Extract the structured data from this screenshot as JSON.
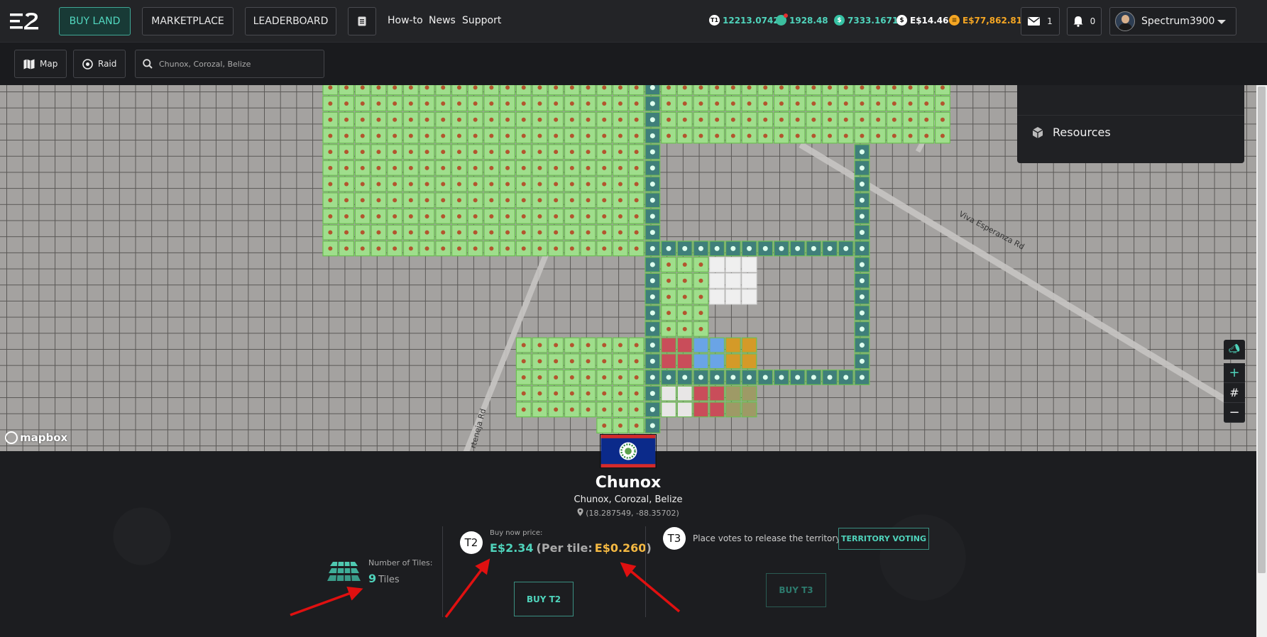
{
  "nav": {
    "buy_land": "BUY LAND",
    "marketplace": "MARKETPLACE",
    "leaderboard": "LEADERBOARD",
    "links": [
      "How-to",
      "News",
      "Support"
    ],
    "stats": [
      {
        "icon": "t1-token-icon",
        "value": "12213.0742",
        "color": "#4fd3bb"
      },
      {
        "icon": "essence-icon",
        "value": "1928.48",
        "color": "#4fd3bb"
      },
      {
        "icon": "coin-icon",
        "value": "7333.1671",
        "color": "#4fd3bb"
      },
      {
        "icon": "dollar-icon",
        "value": "E$14.46",
        "color": "#ffffff"
      },
      {
        "icon": "gold-coin-icon",
        "value": "E$77,862.81",
        "color": "#f5a623"
      }
    ],
    "mail_count": "1",
    "notification_count": "0",
    "username": "Spectrum3900"
  },
  "toolbar": {
    "map_label": "Map",
    "raid_label": "Raid",
    "search_placeholder": "Chunox, Corozal, Belize"
  },
  "map": {
    "road_label_1": "Viva Esperanza Rd",
    "road_label_2": "rteneja Rd",
    "attribution": "mapbox",
    "resources_label": "Resources"
  },
  "territory": {
    "name": "Chunox",
    "location": "Chunox, Corozal, Belize",
    "coordinates": "(18.287549, -88.35702)",
    "tiles_label": "Number of Tiles:",
    "tiles_count": "9",
    "tiles_unit": "Tiles",
    "t2_badge": "T2",
    "buy_now_label": "Buy now price:",
    "buy_now_price": "E$2.34",
    "per_tile_label": "(Per tile:",
    "per_tile_price": "E$0.260",
    "per_tile_close": ")",
    "buy_t2": "BUY T2",
    "t3_badge": "T3",
    "votes_text": "Place votes to release the territory",
    "territory_voting": "TERRITORY VOTING",
    "buy_t3": "BUY T3"
  },
  "colors": {
    "accent": "#4fd3bb",
    "price_gold": "#f5b942",
    "annotation_red": "#e01010"
  }
}
